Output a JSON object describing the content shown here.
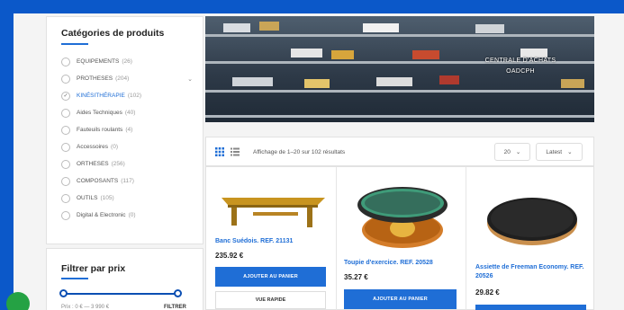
{
  "sidebar": {
    "categories_title": "Catégories de produits",
    "categories": [
      {
        "label": "EQUIPEMENTS",
        "count": "(26)"
      },
      {
        "label": "PROTHESES",
        "count": "(204)"
      },
      {
        "label": "KINÉSITHÉRAPIE",
        "count": "(102)"
      },
      {
        "label": "Aides Techniques",
        "count": "(40)"
      },
      {
        "label": "Fauteuils roulants",
        "count": "(4)"
      },
      {
        "label": "Accessoires",
        "count": "(0)"
      },
      {
        "label": "ORTHESES",
        "count": "(256)"
      },
      {
        "label": "COMPOSANTS",
        "count": "(117)"
      },
      {
        "label": "OUTILS",
        "count": "(105)"
      },
      {
        "label": "Digital & Electronic",
        "count": "(0)"
      }
    ],
    "price_filter_title": "Filtrer par prix",
    "price_range": "Prix : 0 € — 3 990 €",
    "filter_button": "FILTRER"
  },
  "banner": {
    "line1": "CENTRALE D'ACHATS",
    "line2": "OADCPH"
  },
  "toolbar": {
    "results": "Affichage de 1–20 sur 102 résultats",
    "per_page": "20",
    "sort": "Latest"
  },
  "products": [
    {
      "title": "Banc Suédois. REF. 21131",
      "price": "235.92 €",
      "add_label": "AJOUTER AU PANIER",
      "quick_label": "VUE RAPIDE"
    },
    {
      "title": "Toupie d'exercice. REF. 20528",
      "price": "35.27 €",
      "add_label": "AJOUTER AU PANIER"
    },
    {
      "title": "Assiette de Freeman Economy. REF. 20526",
      "price": "29.82 €"
    }
  ],
  "colors": {
    "accent": "#1f6ed6",
    "frame": "#0b58c9",
    "chat": "#25a244"
  }
}
